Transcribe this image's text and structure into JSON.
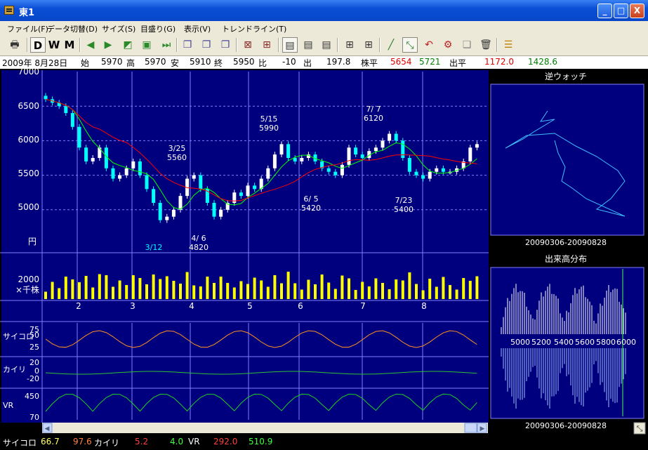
{
  "window": {
    "title": "東1",
    "min_label": "_",
    "max_label": "□",
    "close_label": "X"
  },
  "menu": [
    "ファイル(F)",
    "データ切替(D)",
    "サイズ(S)",
    "目盛り(G)",
    "表示(V)",
    "トレンドライン(T)"
  ],
  "toolbar": {
    "d_label": "D",
    "w_label": "W",
    "m_label": "M"
  },
  "info": {
    "date": "2009年 8月28日",
    "open_label": "始",
    "open": "5970",
    "high_label": "高",
    "high": "5970",
    "low_label": "安",
    "low": "5910",
    "close_label": "終",
    "close": "5950",
    "change_label": "比",
    "change": "-10",
    "volume_label": "出",
    "volume": "197.8",
    "avg_label": "株平",
    "avg1": "5654",
    "avg2": "5721",
    "vol_avg_label": "出平",
    "vol_avg1": "1172.0",
    "vol_avg2": "1428.6"
  },
  "price_axis": [
    "7000",
    "6500",
    "6000",
    "5500",
    "5000"
  ],
  "price_unit": "円",
  "volume_axis": {
    "value": "2000",
    "unit": "×千株"
  },
  "month_labels": [
    "2",
    "3",
    "4",
    "5",
    "6",
    "7",
    "8"
  ],
  "annotations": [
    {
      "date": "3/25",
      "price": "5560"
    },
    {
      "date": "5/15",
      "price": "5990"
    },
    {
      "date": "7/ 7",
      "price": "6120"
    },
    {
      "date": "6/ 5",
      "price": "5420"
    },
    {
      "date": "7/23",
      "price": "5400"
    },
    {
      "date": "4/ 6",
      "price": "4820"
    },
    {
      "date": "3/12",
      "price": ""
    }
  ],
  "indicators": {
    "psy_label": "サイコロ",
    "psy_ticks": [
      "75",
      "50",
      "25"
    ],
    "kairi_label": "カイリ",
    "kairi_ticks": [
      "20",
      "0",
      "-20"
    ],
    "vr_label": "VR",
    "vr_ticks": [
      "450",
      "70"
    ]
  },
  "side": {
    "watch_title": "逆ウォッチ",
    "watch_range": "20090306-20090828",
    "dist_title": "出来高分布",
    "dist_range": "20090306-20090828",
    "dist_ticks": [
      "5000",
      "5200",
      "5400",
      "5600",
      "5800",
      "6000"
    ]
  },
  "status": {
    "psy_label": "サイコロ",
    "psy1": "66.7",
    "psy2": "97.6",
    "kairi_label": "カイリ",
    "kairi1": "5.2",
    "kairi2": "4.0",
    "vr_label": "VR",
    "vr1": "292.0",
    "vr2": "510.9"
  },
  "colors": {
    "panel": "#00007f",
    "grid": "#8080ff",
    "up": "#ffffff",
    "down": "#00ffff",
    "ma_short": "#00ff00",
    "ma_long": "#ff0000",
    "volume": "#ffff00"
  },
  "chart_data": {
    "type": "candlestick",
    "title": "",
    "price_range": [
      4500,
      7000
    ],
    "key_points": [
      {
        "label": "3/12",
        "value": null
      },
      {
        "label": "3/25",
        "value": 5560
      },
      {
        "label": "4/6",
        "value": 4820
      },
      {
        "label": "5/15",
        "value": 5990
      },
      {
        "label": "6/5",
        "value": 5420
      },
      {
        "label": "7/7",
        "value": 6120
      },
      {
        "label": "7/23",
        "value": 5400
      }
    ],
    "close_series": [
      6600,
      6550,
      6500,
      6400,
      6200,
      5900,
      5700,
      5750,
      5900,
      5600,
      5450,
      5500,
      5600,
      5700,
      5500,
      5300,
      5100,
      4850,
      4900,
      5000,
      5200,
      5450,
      5500,
      5300,
      5100,
      4900,
      5000,
      5100,
      5250,
      5200,
      5350,
      5300,
      5450,
      5600,
      5800,
      5950,
      5750,
      5700,
      5750,
      5800,
      5700,
      5600,
      5550,
      5500,
      5650,
      5900,
      5800,
      5750,
      5850,
      5900,
      6000,
      6100,
      6000,
      5750,
      5550,
      5500,
      5450,
      5550,
      5600,
      5550,
      5550,
      5600,
      5700,
      5900,
      5950
    ]
  }
}
